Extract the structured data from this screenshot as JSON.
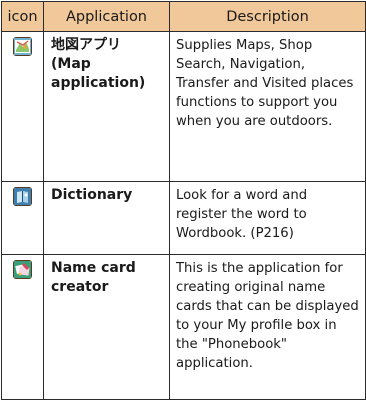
{
  "table": {
    "headers": {
      "icon": "icon",
      "application": "Application",
      "description": "Description"
    },
    "rows": [
      {
        "icon": "map-app-icon",
        "application": "地図アプリ (Map application)",
        "description": "Supplies Maps, Shop Search, Navigation, Transfer and Visited places functions to support you when you are outdoors."
      },
      {
        "icon": "dictionary-app-icon",
        "application": "Dictionary",
        "description": "Look for a word and register the word to Wordbook. (P216)"
      },
      {
        "icon": "name-card-creator-icon",
        "application": "Name card creator",
        "description": "This is the application for creating original name cards that can be displayed to your My profile box in the \"Phonebook\" application."
      }
    ]
  },
  "colors": {
    "header_bg": "#f1c89a",
    "border": "#2b2b2b"
  }
}
